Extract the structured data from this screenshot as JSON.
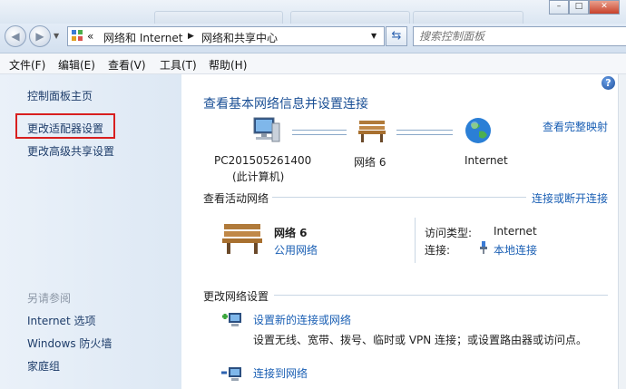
{
  "address": {
    "chevron": "«",
    "crumbs": [
      "网络和 Internet",
      "网络和共享中心"
    ],
    "search_placeholder": "搜索控制面板"
  },
  "menubar": {
    "items": [
      "文件(F)",
      "编辑(E)",
      "查看(V)",
      "工具(T)",
      "帮助(H)"
    ]
  },
  "leftpane": {
    "home": "控制面板主页",
    "change_adapter": "更改适配器设置",
    "change_sharing": "更改高级共享设置",
    "see_also": "另请参阅",
    "internet_options": "Internet 选项",
    "firewall": "Windows 防火墙",
    "homegroup": "家庭组"
  },
  "main": {
    "title": "查看基本网络信息并设置连接",
    "full_map": "查看完整映射",
    "computer_name": "PC201505261400",
    "computer_sub": "(此计算机)",
    "network_node": "网络 6",
    "internet_node": "Internet",
    "active_title": "查看活动网络",
    "connect_disconnect": "连接或断开连接",
    "network_name": "网络  6",
    "network_type": "公用网络",
    "access_label": "访问类型:",
    "access_value": "Internet",
    "conn_label": "连接:",
    "conn_value": "本地连接",
    "change_title": "更改网络设置",
    "setup_link": "设置新的连接或网络",
    "setup_desc": "设置无线、宽带、拨号、临时或 VPN 连接；或设置路由器或访问点。",
    "connect_link": "连接到网络"
  },
  "colors": {
    "accent": "#1a5fb4",
    "highlight": "#d81f1f"
  }
}
